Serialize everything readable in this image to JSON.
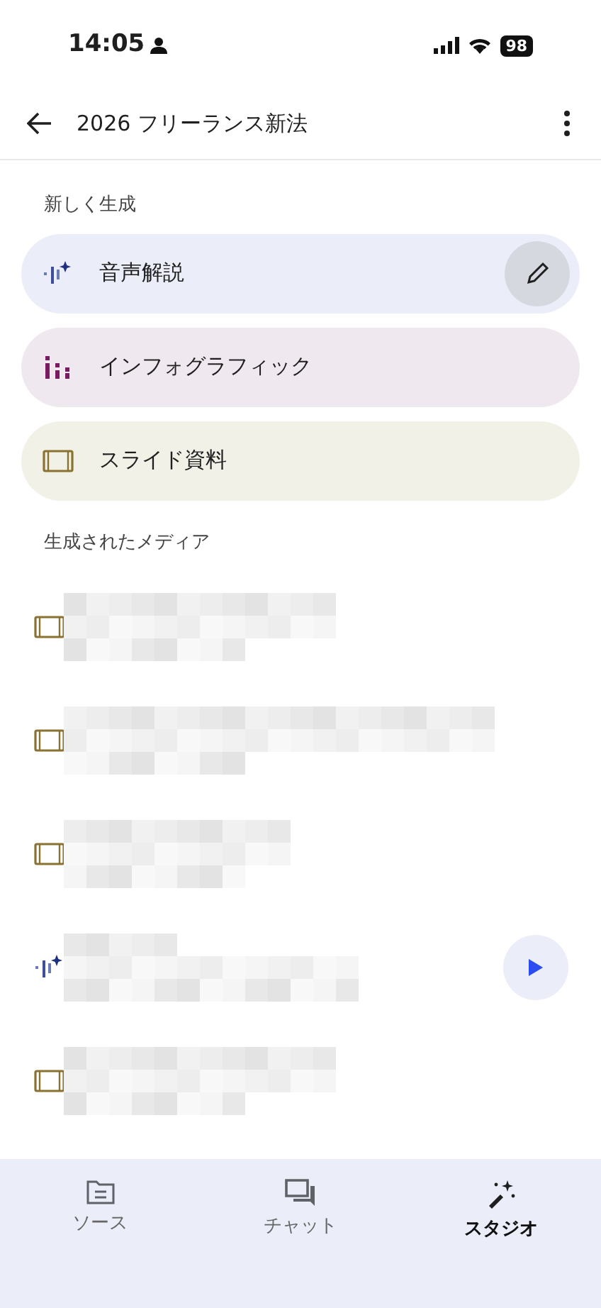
{
  "status_bar": {
    "time": "14:05",
    "battery": "98"
  },
  "header": {
    "title": "2026 フリーランス新法"
  },
  "create_section": {
    "label": "新しく生成",
    "items": [
      {
        "kind": "audio",
        "label": "音声解説",
        "editable": true
      },
      {
        "kind": "infographic",
        "label": "インフォグラフィック",
        "editable": false
      },
      {
        "kind": "slides",
        "label": "スライド資料",
        "editable": false
      }
    ]
  },
  "media_section": {
    "label": "生成されたメディア",
    "items": [
      {
        "kind": "slides",
        "playable": false
      },
      {
        "kind": "slides",
        "playable": false
      },
      {
        "kind": "slides",
        "playable": false
      },
      {
        "kind": "audio",
        "playable": true
      },
      {
        "kind": "slides",
        "playable": false
      }
    ]
  },
  "bottom_nav": [
    {
      "kind": "sources",
      "label": "ソース",
      "selected": false
    },
    {
      "kind": "chat",
      "label": "チャット",
      "selected": false
    },
    {
      "kind": "studio",
      "label": "スタジオ",
      "selected": true
    }
  ]
}
